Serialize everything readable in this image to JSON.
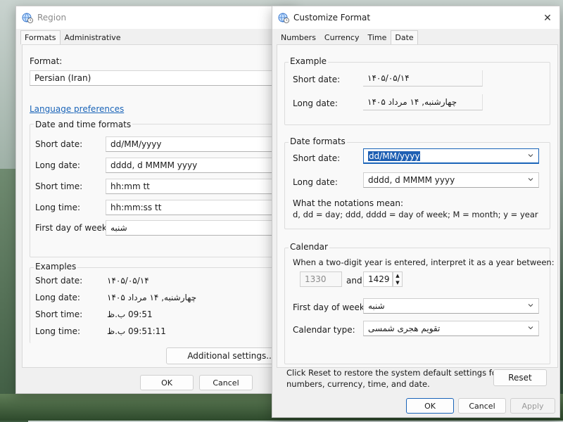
{
  "region": {
    "title": "Region",
    "tabs": [
      "Formats",
      "Administrative"
    ],
    "format_label": "Format:",
    "format_value": "Persian (Iran)",
    "language_link": "Language preferences",
    "dt_group": "Date and time formats",
    "dt_rows": [
      {
        "label": "Short date:",
        "value": "dd/MM/yyyy"
      },
      {
        "label": "Long date:",
        "value": "dddd, d MMMM yyyy"
      },
      {
        "label": "Short time:",
        "value": "hh:mm tt"
      },
      {
        "label": "Long time:",
        "value": "hh:mm:ss tt"
      },
      {
        "label": "First day of week:",
        "value": "شنبه"
      }
    ],
    "examples_group": "Examples",
    "examples": [
      {
        "label": "Short date:",
        "value": "۱۴۰۵/۰۵/۱۴"
      },
      {
        "label": "Long date:",
        "value": "چهارشنبه, ۱۴ مرداد ۱۴۰۵"
      },
      {
        "label": "Short time:",
        "value": "09:51 ب.ظ"
      },
      {
        "label": "Long time:",
        "value": "09:51:11 ب.ظ"
      }
    ],
    "additional_btn": "Additional settings...",
    "ok": "OK",
    "cancel": "Cancel"
  },
  "customize": {
    "title": "Customize Format",
    "tabs": [
      "Numbers",
      "Currency",
      "Time",
      "Date"
    ],
    "active_tab": "Date",
    "example_group": "Example",
    "short_date_label": "Short date:",
    "short_date_example": "۱۴۰۵/۰۵/۱۴",
    "long_date_label": "Long date:",
    "long_date_example": "چهارشنبه, ۱۴ مرداد ۱۴۰۵",
    "formats_group": "Date formats",
    "short_date_format": "dd/MM/yyyy",
    "long_date_format": "dddd, d MMMM yyyy",
    "notation_title": "What the notations mean:",
    "notation_text": "d, dd = day;  ddd, dddd = day of week;  M = month;  y = year",
    "calendar_group": "Calendar",
    "two_digit_text": "When a two-digit year is entered, interpret it as a year between:",
    "year_from": "1330",
    "and_label": "and",
    "year_to": "1429",
    "first_day_label": "First day of week:",
    "first_day_value": "شنبه",
    "calendar_type_label": "Calendar type:",
    "calendar_type_value": "تقویم هجری شمسی",
    "reset_text_1": "Click Reset to restore the system default settings for",
    "reset_text_2": "numbers, currency, time, and date.",
    "reset_btn": "Reset",
    "ok": "OK",
    "cancel": "Cancel",
    "apply": "Apply",
    "close": "✕"
  },
  "colors": {
    "accent": "#1a64b8",
    "selection": "#1e5fb3"
  }
}
